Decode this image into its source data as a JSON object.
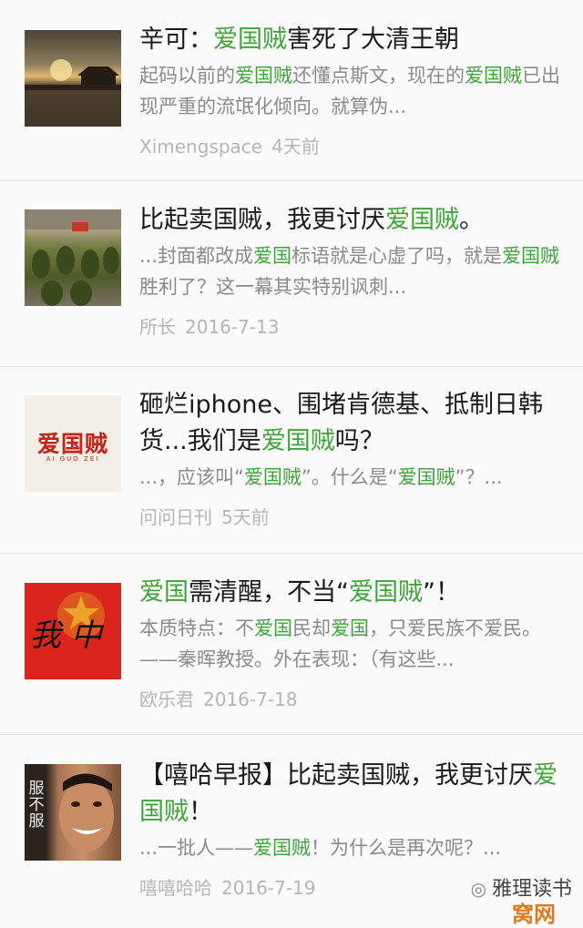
{
  "articles": [
    {
      "title": [
        {
          "t": "辛可：",
          "hl": false
        },
        {
          "t": "爱国贼",
          "hl": true
        },
        {
          "t": "害死了大清王朝",
          "hl": false
        }
      ],
      "snippet": [
        {
          "t": "起码以前的",
          "hl": false
        },
        {
          "t": "爱国贼",
          "hl": true
        },
        {
          "t": "还懂点斯文，现在的",
          "hl": false
        },
        {
          "t": "爱国贼",
          "hl": true
        },
        {
          "t": "已出现严重的流氓化倾向。就算伪...",
          "hl": false
        }
      ],
      "source": "Ximengspace",
      "date": "4天前"
    },
    {
      "title": [
        {
          "t": "比起卖国贼，我更讨厌",
          "hl": false
        },
        {
          "t": "爱国贼",
          "hl": true
        },
        {
          "t": "。",
          "hl": false
        }
      ],
      "snippet": [
        {
          "t": "...封面都改成",
          "hl": false
        },
        {
          "t": "爱国",
          "hl": true
        },
        {
          "t": "标语就是心虚了吗，就是",
          "hl": false
        },
        {
          "t": "爱国贼",
          "hl": true
        },
        {
          "t": "胜利了？这一幕其实特别讽刺...",
          "hl": false
        }
      ],
      "source": "所长",
      "date": "2016-7-13"
    },
    {
      "title": [
        {
          "t": "砸烂iphone、围堵肯德基、抵制日韩货...我们是",
          "hl": false
        },
        {
          "t": "爱国贼",
          "hl": true
        },
        {
          "t": "吗？",
          "hl": false
        }
      ],
      "snippet": [
        {
          "t": "...，应该叫“",
          "hl": false
        },
        {
          "t": "爱国贼",
          "hl": true
        },
        {
          "t": "”。什么是“",
          "hl": false
        },
        {
          "t": "爱国贼",
          "hl": true
        },
        {
          "t": "”？...",
          "hl": false
        }
      ],
      "source": "问问日刊",
      "date": "5天前",
      "logo_text": "爱国贼",
      "logo_sub": "AI GUO ZEI"
    },
    {
      "title": [
        {
          "t": "爱国",
          "hl": true
        },
        {
          "t": "需清醒，不当“",
          "hl": false
        },
        {
          "t": "爱国贼",
          "hl": true
        },
        {
          "t": "”！",
          "hl": false
        }
      ],
      "snippet": [
        {
          "t": "本质特点：不",
          "hl": false
        },
        {
          "t": "爱国",
          "hl": true
        },
        {
          "t": "民却",
          "hl": false
        },
        {
          "t": "爱国",
          "hl": true
        },
        {
          "t": "，只爱民族不爱民。——秦晖教授。外在表现：（有这些...",
          "hl": false
        }
      ],
      "source": "欧乐君",
      "date": "2016-7-18",
      "callig_text": "我 中"
    },
    {
      "title": [
        {
          "t": "【嘻哈早报】比起卖国贼，我更讨厌",
          "hl": false
        },
        {
          "t": "爱国贼",
          "hl": true
        },
        {
          "t": "！",
          "hl": false
        }
      ],
      "snippet": [
        {
          "t": "...一批人——",
          "hl": false
        },
        {
          "t": "爱国贼",
          "hl": true
        },
        {
          "t": "！为什么是再次呢？...",
          "hl": false
        }
      ],
      "source": "嘻嘻哈哈",
      "date": "2016-7-19",
      "side_text": "服不服"
    }
  ],
  "watermark": {
    "text": "雅理读书",
    "icon": "wechat-icon",
    "site": "窝网"
  },
  "colors": {
    "highlight": "#3fa43a",
    "title": "#1a1a1a",
    "snippet": "#8a8a8a",
    "meta": "#b5b5b5"
  }
}
